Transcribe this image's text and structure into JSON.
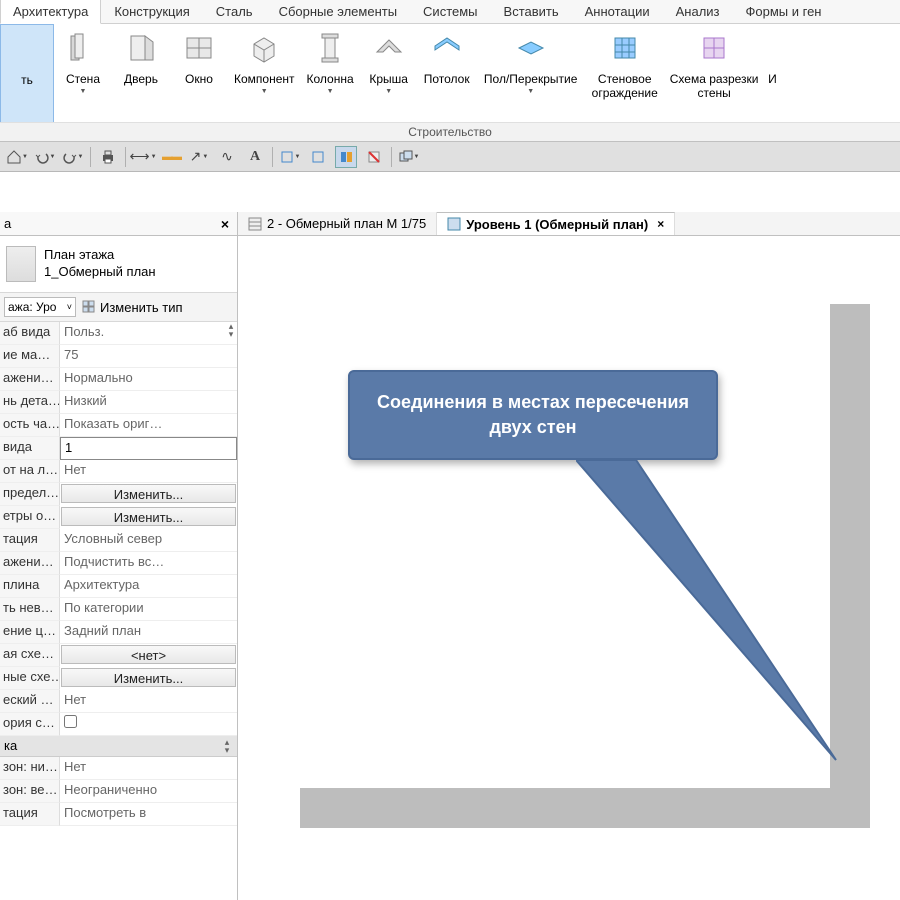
{
  "ribbon": {
    "tabs": [
      "Архитектура",
      "Конструкция",
      "Сталь",
      "Сборные элементы",
      "Системы",
      "Вставить",
      "Аннотации",
      "Анализ",
      "Формы и ген"
    ],
    "active_tab": 0,
    "buttons": {
      "modify": "ть",
      "wall": "Стена",
      "door": "Дверь",
      "window": "Окно",
      "component": "Компонент",
      "column": "Колонна",
      "roof": "Крыша",
      "ceiling": "Потолок",
      "floor": "Пол/Перекрытие",
      "curtain_wall": "Стеновое\nограждение",
      "curtain_grid": "Схема разрезки\nстены",
      "extra": "И"
    },
    "group_label": "Строительство"
  },
  "doc_tabs": {
    "inactive": "2 - Обмерный план М 1/75",
    "active": "Уровень 1 (Обмерный план)"
  },
  "props": {
    "title_suffix": "а",
    "type1": "План этажа",
    "type2": "1_Обмерный план",
    "instance_dd": "ажа: Уро",
    "edit_type": "Изменить тип",
    "rows": [
      {
        "n": "аб вида",
        "v": "Польз.",
        "t": "ro"
      },
      {
        "n": "ие ма…",
        "v": "75",
        "t": "ro"
      },
      {
        "n": "ажени…",
        "v": "Нормально",
        "t": "ro"
      },
      {
        "n": "нь дета…",
        "v": "Низкий",
        "t": "ro"
      },
      {
        "n": "ость ча…",
        "v": "Показать ориг…",
        "t": "ro"
      },
      {
        "n": " вида",
        "v": "1",
        "t": "edit"
      },
      {
        "n": "от на л…",
        "v": "Нет",
        "t": "ro"
      },
      {
        "n": "предел…",
        "v": "Изменить...",
        "t": "btn"
      },
      {
        "n": "етры о…",
        "v": "Изменить...",
        "t": "btn"
      },
      {
        "n": "тация",
        "v": "Условный север",
        "t": "ro"
      },
      {
        "n": "ажени…",
        "v": "Подчистить вс…",
        "t": "ro"
      },
      {
        "n": "плина",
        "v": "Архитектура",
        "t": "ro"
      },
      {
        "n": "ть нев…",
        "v": "По категории",
        "t": "ro"
      },
      {
        "n": "ение ц…",
        "v": "Задний план",
        "t": "ro"
      },
      {
        "n": "ая схе…",
        "v": "<нет>",
        "t": "dd"
      },
      {
        "n": "ные схе…",
        "v": "Изменить...",
        "t": "btn"
      },
      {
        "n": "еский …",
        "v": "Нет",
        "t": "ro"
      },
      {
        "n": "ория с…",
        "v": "",
        "t": "check"
      }
    ],
    "group2": "ка",
    "rows2": [
      {
        "n": "зон: ни…",
        "v": "Нет",
        "t": "ro"
      },
      {
        "n": "зон: ве…",
        "v": "Неограниченно",
        "t": "ro"
      },
      {
        "n": "тация",
        "v": "Посмотреть в",
        "t": "ro"
      }
    ]
  },
  "callout_text": "Соединения в местах пересечения двух стен"
}
